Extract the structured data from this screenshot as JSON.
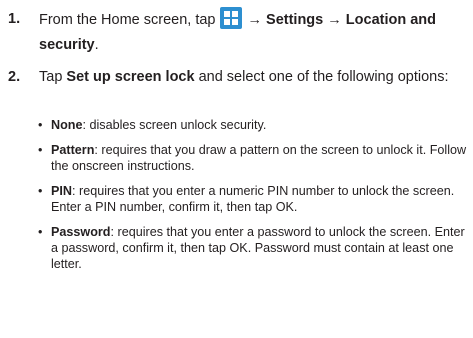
{
  "steps": [
    {
      "number": "1.",
      "text_before": "From the Home screen, tap",
      "icon": "apps-grid-icon",
      "icon_color": "#2d8fd0",
      "path": "→ Settings → Location and security",
      "text_after": "."
    },
    {
      "number": "2.",
      "text_before": "Tap ",
      "bold": "Set up screen lock",
      "text_after": " and select one of the following options:"
    }
  ],
  "options": [
    {
      "name": "None",
      "description": ": disables screen unlock security."
    },
    {
      "name": "Pattern",
      "description": ": requires that you draw a pattern on the screen to unlock it. Follow the onscreen instructions."
    },
    {
      "name": "PIN",
      "description": ": requires that you enter a numeric PIN number to unlock the screen. Enter a PIN number, confirm it, then tap OK."
    },
    {
      "name": "Password",
      "description": ": requires that you enter a password to unlock the screen. Enter a password, confirm it, then tap OK. Password must contain at least one letter."
    }
  ],
  "bullet_glyph": "•"
}
